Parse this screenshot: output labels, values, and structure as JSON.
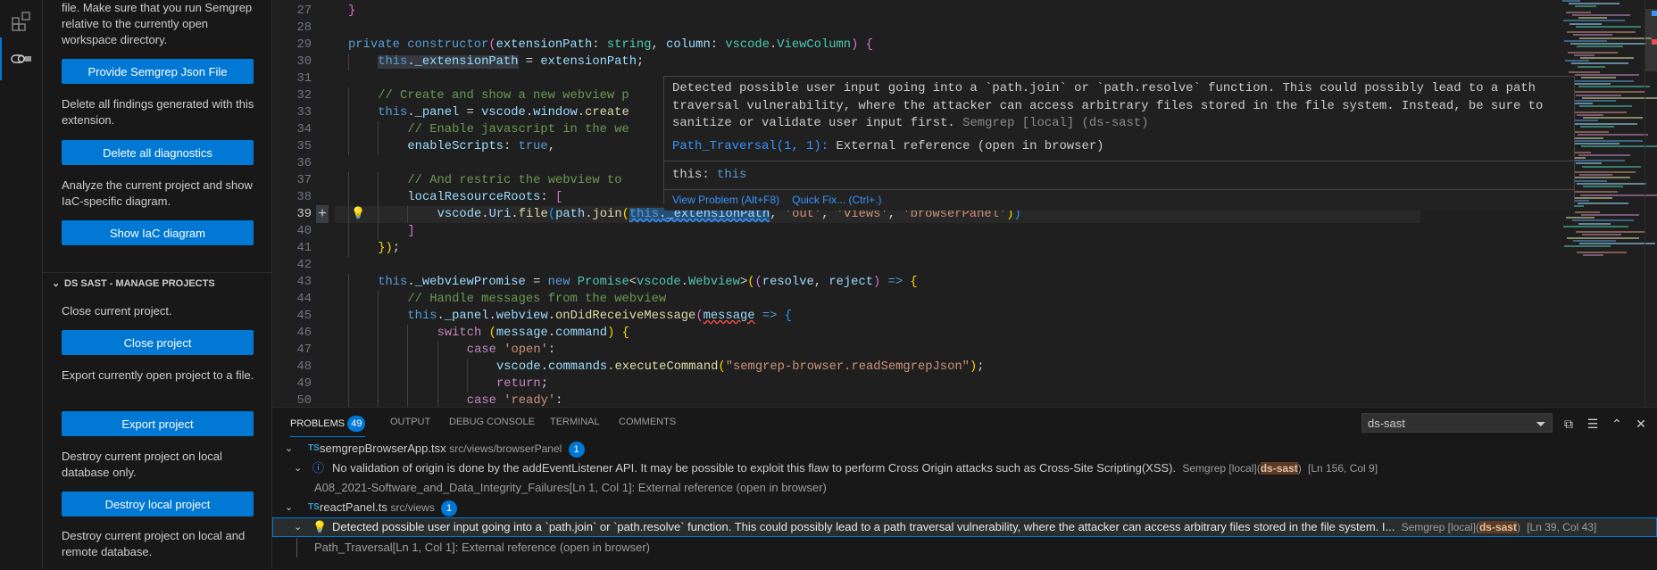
{
  "activity_bar": {
    "icons": [
      "extensions-icon",
      "semgrep-icon"
    ]
  },
  "sidebar": {
    "top_section": [
      {
        "text": "file. Make sure that you run Semgrep relative to the currently open workspace directory.",
        "button": "Provide Semgrep Json File"
      },
      {
        "text": "Delete all findings generated with this extension.",
        "button": "Delete all diagnostics"
      },
      {
        "text": "Analyze the current project and show IaC-specific diagram.",
        "button": "Show IaC diagram"
      }
    ],
    "manage_header": "DS SAST - MANAGE PROJECTS",
    "manage_section": [
      {
        "text": "Close current project.",
        "button": "Close project"
      },
      {
        "text": "Export currently open project to a file.",
        "button": "Export project"
      },
      {
        "text": "Destroy current project on local database only.",
        "button": "Destroy local project"
      },
      {
        "text": "Destroy current project on local and remote database.",
        "button": ""
      }
    ]
  },
  "editor": {
    "current_line": 39,
    "lines": [
      {
        "n": "27",
        "indent": 1,
        "tokens": [
          [
            "m",
            "}"
          ]
        ]
      },
      {
        "n": "28",
        "indent": 0,
        "tokens": []
      },
      {
        "n": "29",
        "indent": 1,
        "tokens": [
          [
            "k",
            "private"
          ],
          [
            "d",
            " "
          ],
          [
            "k",
            "constructor"
          ],
          [
            "m",
            "("
          ],
          [
            "v",
            "extensionPath"
          ],
          [
            "d",
            ": "
          ],
          [
            "t",
            "string"
          ],
          [
            "d",
            ", "
          ],
          [
            "v",
            "column"
          ],
          [
            "d",
            ": "
          ],
          [
            "t",
            "vscode"
          ],
          [
            "d",
            "."
          ],
          [
            "t",
            "ViewColumn"
          ],
          [
            "m",
            ")"
          ],
          [
            "d",
            " "
          ],
          [
            "m",
            "{"
          ]
        ]
      },
      {
        "n": "30",
        "indent": 2,
        "tokens": [
          [
            "k hl",
            "this"
          ],
          [
            "d hl",
            "."
          ],
          [
            "v hl",
            "_extensionPath"
          ],
          [
            "d",
            " = "
          ],
          [
            "v",
            "extensionPath"
          ],
          [
            "d",
            ";"
          ]
        ]
      },
      {
        "n": "31",
        "indent": 0,
        "tokens": []
      },
      {
        "n": "32",
        "indent": 2,
        "tokens": [
          [
            "c",
            "// Create and show a new webview p"
          ]
        ]
      },
      {
        "n": "33",
        "indent": 2,
        "tokens": [
          [
            "k",
            "this"
          ],
          [
            "d",
            "."
          ],
          [
            "v",
            "_panel"
          ],
          [
            "d",
            " = "
          ],
          [
            "v",
            "vscode"
          ],
          [
            "d",
            "."
          ],
          [
            "v",
            "window"
          ],
          [
            "d",
            "."
          ],
          [
            "f",
            "create"
          ]
        ]
      },
      {
        "n": "34",
        "indent": 3,
        "tokens": [
          [
            "c",
            "// Enable javascript in the we"
          ]
        ]
      },
      {
        "n": "35",
        "indent": 3,
        "tokens": [
          [
            "v",
            "enableScripts"
          ],
          [
            "d",
            ": "
          ],
          [
            "k",
            "true"
          ],
          [
            "d",
            ","
          ]
        ]
      },
      {
        "n": "36",
        "indent": 0,
        "tokens": []
      },
      {
        "n": "37",
        "indent": 3,
        "tokens": [
          [
            "c",
            "// And restric the webview to"
          ]
        ]
      },
      {
        "n": "38",
        "indent": 3,
        "tokens": [
          [
            "v",
            "localResourceRoots"
          ],
          [
            "d",
            ": "
          ],
          [
            "m",
            "["
          ]
        ]
      },
      {
        "n": "39",
        "indent": 4,
        "tokens": [
          [
            "v",
            "vscode"
          ],
          [
            "d",
            "."
          ],
          [
            "v",
            "Uri"
          ],
          [
            "d",
            "."
          ],
          [
            "f",
            "file"
          ],
          [
            "b",
            "("
          ],
          [
            "v",
            "path"
          ],
          [
            "d",
            "."
          ],
          [
            "f",
            "join"
          ],
          [
            "y",
            "("
          ],
          [
            "k sq",
            "this"
          ],
          [
            "d sq",
            "."
          ],
          [
            "v sq",
            "_extensionPath"
          ],
          [
            "d",
            ", "
          ],
          [
            "s",
            "'out'"
          ],
          [
            "d",
            ", "
          ],
          [
            "s",
            "'views'"
          ],
          [
            "d",
            ", "
          ],
          [
            "s",
            "'browserPanel'"
          ],
          [
            "y",
            ")"
          ],
          [
            "b",
            ")"
          ]
        ]
      },
      {
        "n": "40",
        "indent": 3,
        "tokens": [
          [
            "m",
            "]"
          ]
        ]
      },
      {
        "n": "41",
        "indent": 2,
        "tokens": [
          [
            "y",
            "})"
          ],
          [
            "d",
            ";"
          ]
        ]
      },
      {
        "n": "42",
        "indent": 0,
        "tokens": []
      },
      {
        "n": "43",
        "indent": 2,
        "tokens": [
          [
            "k",
            "this"
          ],
          [
            "d",
            "."
          ],
          [
            "v",
            "_webviewPromise"
          ],
          [
            "d",
            " = "
          ],
          [
            "k",
            "new"
          ],
          [
            "d",
            " "
          ],
          [
            "t",
            "Promise"
          ],
          [
            "d",
            "<"
          ],
          [
            "t",
            "vscode"
          ],
          [
            "d",
            "."
          ],
          [
            "t",
            "Webview"
          ],
          [
            "d",
            ">"
          ],
          [
            "y",
            "("
          ],
          [
            "m",
            "("
          ],
          [
            "v",
            "resolve"
          ],
          [
            "d",
            ", "
          ],
          [
            "v",
            "reject"
          ],
          [
            "m",
            ")"
          ],
          [
            "d",
            " "
          ],
          [
            "k",
            "=>"
          ],
          [
            "d",
            " "
          ],
          [
            "y",
            "{"
          ]
        ]
      },
      {
        "n": "44",
        "indent": 3,
        "tokens": [
          [
            "c",
            "// Handle messages from the webview"
          ]
        ]
      },
      {
        "n": "45",
        "indent": 3,
        "tokens": [
          [
            "k",
            "this"
          ],
          [
            "d",
            "."
          ],
          [
            "v",
            "_panel"
          ],
          [
            "d",
            "."
          ],
          [
            "v",
            "webview"
          ],
          [
            "d",
            "."
          ],
          [
            "f",
            "onDidReceiveMessage"
          ],
          [
            "m",
            "("
          ],
          [
            "v sqr",
            "message"
          ],
          [
            "d",
            " "
          ],
          [
            "k",
            "=>"
          ],
          [
            "d",
            " "
          ],
          [
            "b",
            "{"
          ]
        ]
      },
      {
        "n": "46",
        "indent": 4,
        "tokens": [
          [
            "p",
            "switch"
          ],
          [
            "d",
            " "
          ],
          [
            "y",
            "("
          ],
          [
            "v",
            "message"
          ],
          [
            "d",
            "."
          ],
          [
            "v",
            "command"
          ],
          [
            "y",
            ")"
          ],
          [
            "d",
            " "
          ],
          [
            "y",
            "{"
          ]
        ]
      },
      {
        "n": "47",
        "indent": 5,
        "tokens": [
          [
            "p",
            "case"
          ],
          [
            "d",
            " "
          ],
          [
            "s",
            "'open'"
          ],
          [
            "d",
            ":"
          ]
        ]
      },
      {
        "n": "48",
        "indent": 6,
        "tokens": [
          [
            "v",
            "vscode"
          ],
          [
            "d",
            "."
          ],
          [
            "v",
            "commands"
          ],
          [
            "d",
            "."
          ],
          [
            "f",
            "executeCommand"
          ],
          [
            "y",
            "("
          ],
          [
            "s",
            "\"semgrep-browser.readSemgrepJson\""
          ],
          [
            "y",
            ")"
          ],
          [
            "d",
            ";"
          ]
        ]
      },
      {
        "n": "49",
        "indent": 6,
        "tokens": [
          [
            "p",
            "return"
          ],
          [
            "d",
            ";"
          ]
        ]
      },
      {
        "n": "50",
        "indent": 5,
        "tokens": [
          [
            "p",
            "case"
          ],
          [
            "d",
            " "
          ],
          [
            "s",
            "'ready'"
          ],
          [
            "d",
            ":"
          ]
        ]
      }
    ]
  },
  "hover": {
    "message_lines": [
      "Detected possible user input going into a `path.join` or `path.resolve` function. This could possibly lead to a path",
      "traversal vulnerability,  where the attacker can access arbitrary files stored in the file system. Instead, be sure to",
      "sanitize or validate user input first. "
    ],
    "source": "Semgrep [local] (ds-sast)",
    "ref_link": "Path_Traversal(1, 1):",
    "ref_text": " External reference (open in browser)",
    "type_label": "this: ",
    "type_value": "this",
    "view_problem": "View Problem (Alt+F8)",
    "quick_fix": "Quick Fix... (Ctrl+.)"
  },
  "panel": {
    "tabs": [
      {
        "label": "PROBLEMS",
        "badge": "49",
        "active": true
      },
      {
        "label": "OUTPUT"
      },
      {
        "label": "DEBUG CONSOLE"
      },
      {
        "label": "TERMINAL"
      },
      {
        "label": "COMMENTS"
      }
    ],
    "filter_value": "ds-sast",
    "files": [
      {
        "name": "semgrepBrowserApp.tsx",
        "path": "src/views/browserPanel",
        "count": "1",
        "problem": {
          "severity": "info",
          "message": "No validation of origin is done by the addEventListener API. It may be possible to exploit this flaw to perform Cross Origin attacks such as Cross-Site Scripting(XSS).",
          "source_prefix": "Semgrep [local](",
          "source_match": "ds-sast",
          "source_suffix": ")",
          "location": "[Ln 156, Col 9]"
        },
        "detail": "A08_2021-Software_and_Data_Integrity_Failures[Ln 1, Col 1]: External reference (open in browser)"
      },
      {
        "name": "reactPanel.ts",
        "path": "src/views",
        "count": "1",
        "problem": {
          "severity": "lightbulb",
          "message": "Detected possible user input going into a `path.join` or `path.resolve` function. This could possibly lead to a path traversal vulnerability, where the attacker can access arbitrary files stored in the file system. I...",
          "source_prefix": "Semgrep [local](",
          "source_match": "ds-sast",
          "source_suffix": ")",
          "location": "[Ln 39, Col 43]"
        },
        "detail": "Path_Traversal[Ln 1, Col 1]: External reference (open in browser)"
      }
    ]
  },
  "colors": {
    "accent": "#0078d4",
    "editor_bg": "#1f1f1f",
    "sidebar_bg": "#181818"
  }
}
